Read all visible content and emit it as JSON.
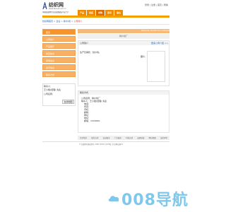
{
  "brand": {
    "title": "纺织网",
    "url": "www.texnet.com.cn",
    "tagline": "中国纺织网专业纺织服装产业门户"
  },
  "top_links": [
    "登录",
    "注册",
    "首页",
    "帮助"
  ],
  "nav": {
    "tabs": [
      "产品",
      "供应",
      "求购",
      "资讯",
      "展会"
    ]
  },
  "breadcrumb": {
    "items": [
      "纺织网首页",
      "企业",
      "棉/纱线"
    ],
    "current": "公司简介"
  },
  "sidebar": {
    "items": [
      "首页",
      "公司简介",
      "产品展厅",
      "供应信息",
      "求购信息",
      "资讯信息",
      "联系方式"
    ]
  },
  "contact": {
    "person_label": "联系人：",
    "person_value": "王小姐(经理) 先生",
    "company_label": "公司名称：",
    "map_button": "在线地图"
  },
  "main": {
    "company_name": "棉纱线厂",
    "head_note": "Welcome, texnet.com.cn/shopid",
    "intro_title": "公司简介",
    "more_link": "更多公司介绍 >>",
    "intro_text": "生产及销售：纺纱线。",
    "photo_caption": "图片：",
    "contact_title": "联系方式",
    "contact_rows": [
      {
        "label": "公司名称：",
        "value": "棉纱线厂"
      },
      {
        "label": "联系人：",
        "value": "王小姐(经理) 先生"
      },
      {
        "label": "电话：",
        "value": ""
      },
      {
        "label": "传真：",
        "value": ""
      },
      {
        "label": "手机：",
        "value": ""
      },
      {
        "label": "邮箱：",
        "value": ""
      },
      {
        "label": "网址：",
        "value": ""
      },
      {
        "label": "地址：",
        "value": ""
      },
      {
        "label": "邮编：",
        "value": "1020000"
      }
    ]
  },
  "footer": {
    "links": [
      "关于我们",
      "联系方式",
      "会员服务",
      "广告服务",
      "付款方式",
      "友情链接",
      "网站地图",
      "法律声明"
    ],
    "copyright": "© 纺织网 版权所有 1997-2019  京ICP证 京公网安备11"
  },
  "watermark": {
    "text": "008导航",
    "color": "#7ec8ec"
  }
}
